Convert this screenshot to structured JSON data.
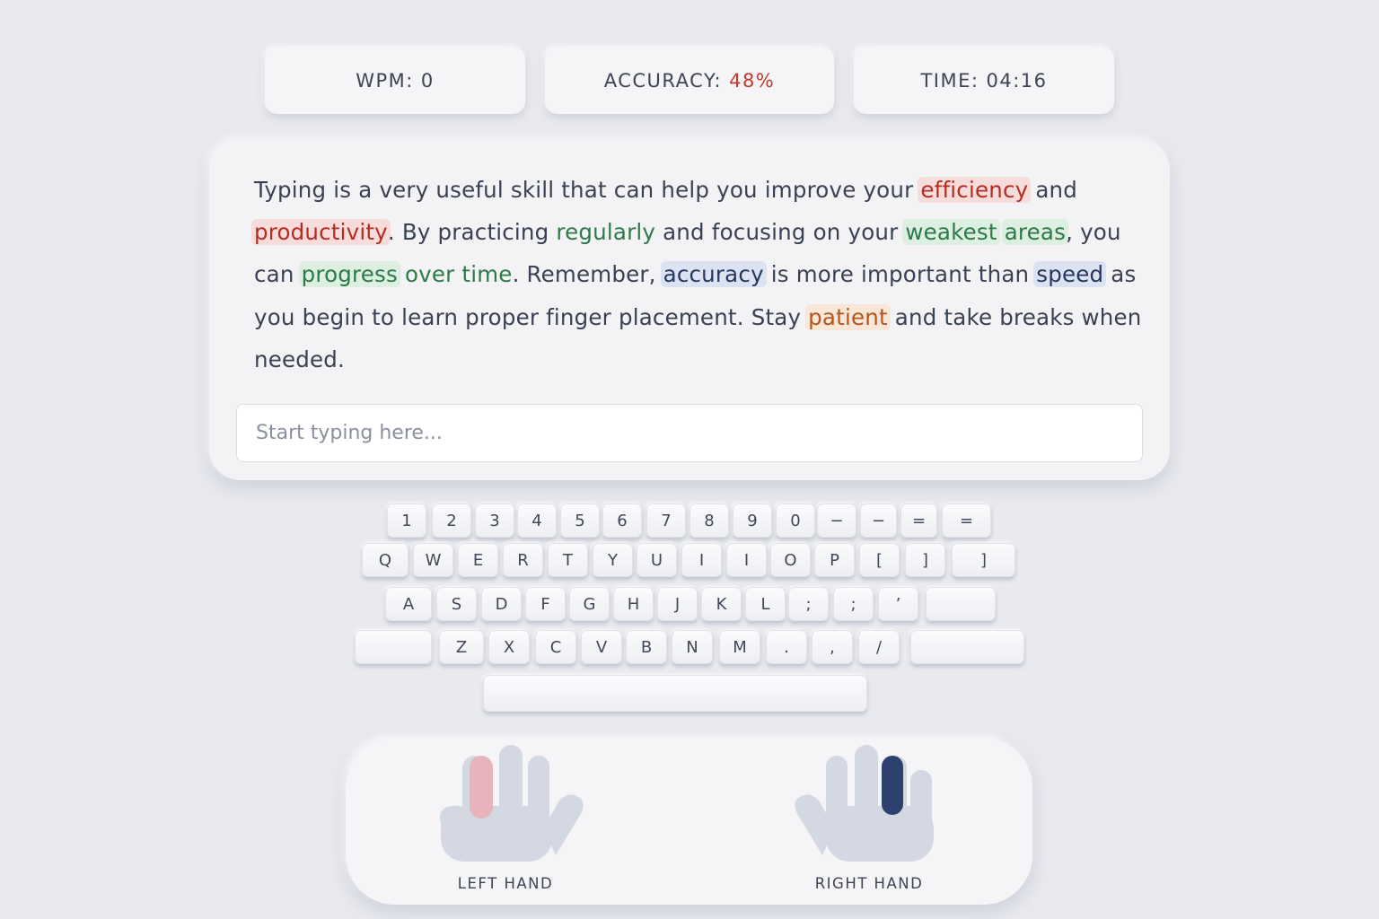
{
  "stats": {
    "wpm_label": "WPM: ",
    "wpm_value": "0",
    "accuracy_label": "ACCURACY: ",
    "accuracy_value": "48%",
    "time_label": "TIME: ",
    "time_value": "04:16"
  },
  "passage": {
    "words": [
      {
        "t": "Typing",
        "s": "first"
      },
      {
        "t": " is a very useful skill that can help you improve your ",
        "s": ""
      },
      {
        "t": "efficiency",
        "s": "red"
      },
      {
        "t": " and ",
        "s": ""
      },
      {
        "t": "productivity",
        "s": "red"
      },
      {
        "t": ". By practicing ",
        "s": ""
      },
      {
        "t": "regularly",
        "s": "greentext"
      },
      {
        "t": " and focusing on your ",
        "s": ""
      },
      {
        "t": "weakest",
        "s": "green"
      },
      {
        "t": " ",
        "s": ""
      },
      {
        "t": "areas",
        "s": "green"
      },
      {
        "t": ", you can ",
        "s": ""
      },
      {
        "t": "progress",
        "s": "green"
      },
      {
        "t": " ",
        "s": ""
      },
      {
        "t": "over time",
        "s": "greentext"
      },
      {
        "t": ". Remember, ",
        "s": ""
      },
      {
        "t": "accuracy",
        "s": "blue"
      },
      {
        "t": " is more important than ",
        "s": ""
      },
      {
        "t": "speed",
        "s": "blue"
      },
      {
        "t": " as you begin to learn proper finger placement. Stay ",
        "s": ""
      },
      {
        "t": "patient",
        "s": "orange"
      },
      {
        "t": " and take breaks when needed.",
        "s": ""
      }
    ]
  },
  "input": {
    "placeholder": "Start typing here...",
    "value": ""
  },
  "keyboard": {
    "row1": [
      "1",
      "2",
      "3",
      "4",
      "5",
      "6",
      "7",
      "8",
      "9",
      "0",
      "−",
      "−",
      "=",
      "="
    ],
    "row2": [
      "Q",
      "W",
      "E",
      "R",
      "T",
      "Y",
      "U",
      "I",
      "I",
      "O",
      "P",
      "[",
      "]",
      "]"
    ],
    "row3": [
      "A",
      "S",
      "D",
      "F",
      "G",
      "H",
      "J",
      "K",
      "L",
      ";",
      ";",
      "’",
      ""
    ],
    "row4": [
      "",
      "Z",
      "X",
      "C",
      "V",
      "B",
      "N",
      "M",
      ".",
      ",",
      "/",
      ""
    ],
    "space": ""
  },
  "hands": {
    "left_label": "LEFT HAND",
    "right_label": "RIGHT HAND",
    "left_active_color": "#e8b4bc",
    "right_active_color": "#2c4170",
    "base_color": "#d3d8e2"
  }
}
